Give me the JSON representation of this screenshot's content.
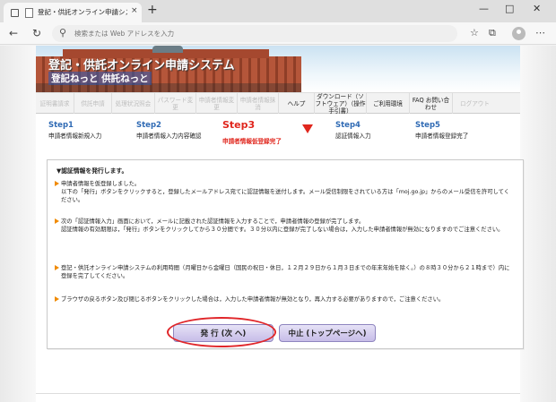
{
  "browser": {
    "tab_title": "登記・供託オンライン申請システム",
    "tab_close": "×",
    "new_tab": "+",
    "address_placeholder": "検索または Web アドレスを入力",
    "address_value": ""
  },
  "site": {
    "brand_title": "登記・供託オンライン申請システム",
    "brand_sub": "登記ねっと 供託ねっと"
  },
  "menu": {
    "items": [
      {
        "label": "証明書請求",
        "active": false
      },
      {
        "label": "供託申請",
        "active": false
      },
      {
        "label": "処理状況照会",
        "active": false
      },
      {
        "label": "パスワード変更",
        "active": false
      },
      {
        "label": "申請者情報変更",
        "active": false
      },
      {
        "label": "申請者情報抹消",
        "active": false
      },
      {
        "label": "ヘルプ",
        "active": true
      },
      {
        "label": "ダウンロード（ソフトウェア）（操作手引書）",
        "active": true
      },
      {
        "label": "ご利用環境",
        "active": true
      },
      {
        "label": "FAQ お問い合わせ",
        "active": true
      },
      {
        "label": "ログアウト",
        "active": false
      }
    ]
  },
  "steps": [
    {
      "num": "Step1",
      "label": "申請者情報新規入力"
    },
    {
      "num": "Step2",
      "label": "申請者情報入力内容確認"
    },
    {
      "num": "Step3",
      "label": "申請者情報仮登録完了"
    },
    {
      "num": "Step4",
      "label": "認証情報入力"
    },
    {
      "num": "Step5",
      "label": "申請者情報登録完了"
    }
  ],
  "message": {
    "title": "▼認証情報を発行します。",
    "p1_line1": "申請者情報を仮登録しました。",
    "p1_line2": "以下の「発行」ボタンをクリックすると，登録したメールアドレス宛てに認証情報を送付します。メール受信制限をされている方は「moj.go.jp」からのメール受信を許可してください。",
    "p2_line1": "次の「認証情報入力」画面において，メールに記載された認証情報を入力することで，申請者情報の登録が完了します。",
    "p2_line2": "認証情報の有効期限は，「発行」ボタンをクリックしてから３０分間です。３０分以内に登録が完了しない場合は，入力した申請者情報が無効になりますのでご注意ください。",
    "p3_line1": "登記・供託オンライン申請システムの利用時間（月曜日から金曜日（国民の祝日・休日，１２月２９日から１月３日までの年末年始を除く。）の８時３０分から２１時まで）内に登録を完了してください。",
    "p4_line1": "ブラウザの戻るボタン及び閉じるボタンをクリックした場合は，入力した申請者情報が無効となり，再入力する必要がありますので，ご注意ください。"
  },
  "buttons": {
    "issue": "発 行 (次 へ)",
    "stop": "中止 (トップページへ)"
  },
  "colors": {
    "step_blue": "#2f6ab4",
    "current_red": "#e0261d",
    "bullet_orange": "#f08a00",
    "button_lavender": "#c7bde8"
  }
}
